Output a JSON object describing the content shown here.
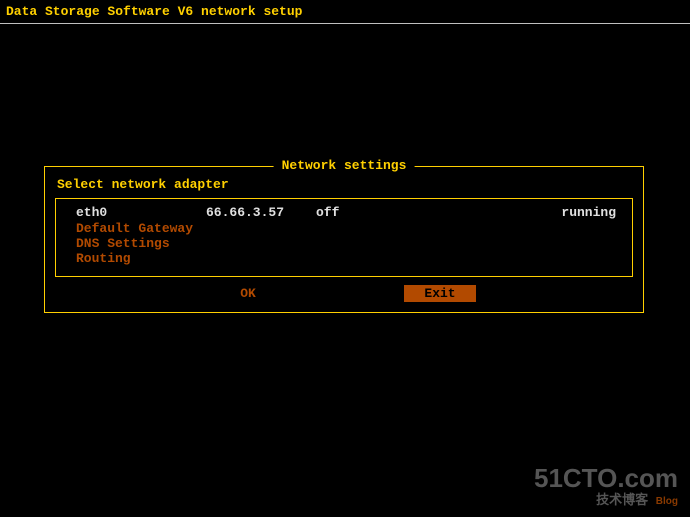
{
  "header": {
    "title": "Data Storage Software V6 network setup"
  },
  "panel": {
    "title": "Network settings",
    "instruction": "Select network adapter"
  },
  "adapter": {
    "name": "eth0",
    "ip": "66.66.3.57",
    "dhcp": "off",
    "status": "running"
  },
  "menu": {
    "items": [
      "Default Gateway",
      "DNS Settings",
      "Routing"
    ]
  },
  "buttons": {
    "ok": "OK",
    "exit": "Exit"
  },
  "watermark": {
    "line1": "51CTO.com",
    "line2": "技术博客",
    "tag": "Blog"
  }
}
